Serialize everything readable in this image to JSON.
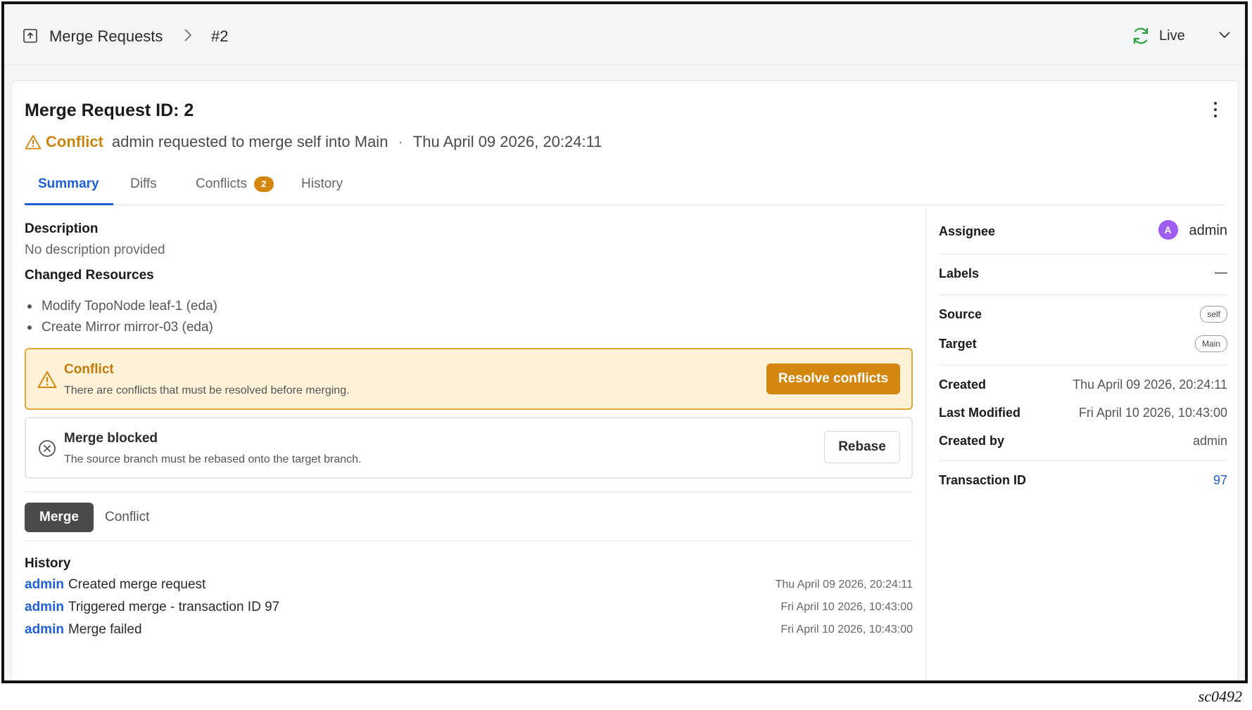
{
  "breadcrumb": {
    "root": "Merge Requests",
    "current": "#2"
  },
  "header": {
    "live_label": "Live"
  },
  "merge_request": {
    "title": "Merge Request ID: 2",
    "status": "Conflict",
    "status_text": "admin requested to merge self into Main",
    "separator": "·",
    "created_date": "Thu April 09 2026, 20:24:11"
  },
  "tabs": [
    {
      "label": "Summary",
      "active": true
    },
    {
      "label": "Diffs",
      "active": false
    },
    {
      "label": "Conflicts",
      "badge": "2",
      "active": false
    },
    {
      "label": "History",
      "active": false
    }
  ],
  "summary": {
    "description_heading": "Description",
    "description_text": "No description provided",
    "changed_resources_heading": "Changed Resources",
    "changed_resources": [
      "Modify TopoNode leaf-1 (eda)",
      "Create Mirror mirror-03 (eda)"
    ]
  },
  "alerts": {
    "conflict": {
      "title": "Conflict",
      "text": "There are conflicts that must be resolved before merging.",
      "button": "Resolve conflicts"
    },
    "blocked": {
      "title": "Merge blocked",
      "text": "The source branch must be rebased onto the target branch.",
      "button": "Rebase"
    }
  },
  "segments": {
    "merge": "Merge",
    "conflict": "Conflict"
  },
  "history": {
    "heading": "History",
    "entries": [
      {
        "user": "admin",
        "action": "Created merge request",
        "date": "Thu April 09 2026, 20:24:11"
      },
      {
        "user": "admin",
        "action": "Triggered merge - transaction ID 97",
        "date": "Fri April 10 2026, 10:43:00"
      },
      {
        "user": "admin",
        "action": "Merge failed",
        "date": "Fri April 10 2026, 10:43:00"
      }
    ]
  },
  "sidebar": {
    "assignee_label": "Assignee",
    "assignee_initial": "A",
    "assignee_name": "admin",
    "labels_label": "Labels",
    "labels_value": "—",
    "source_label": "Source",
    "source_value": "self",
    "target_label": "Target",
    "target_value": "Main",
    "created_label": "Created",
    "created_value": "Thu April 09 2026, 20:24:11",
    "modified_label": "Last Modified",
    "modified_value": "Fri April 10 2026, 10:43:00",
    "created_by_label": "Created by",
    "created_by_value": "admin",
    "transaction_label": "Transaction ID",
    "transaction_value": "97"
  },
  "footer": {
    "code": "sc0492"
  },
  "colors": {
    "accent": "#1e5fd8",
    "warning": "#d4870e",
    "avatar": "#a15cf0",
    "live": "#2a9d3a"
  }
}
